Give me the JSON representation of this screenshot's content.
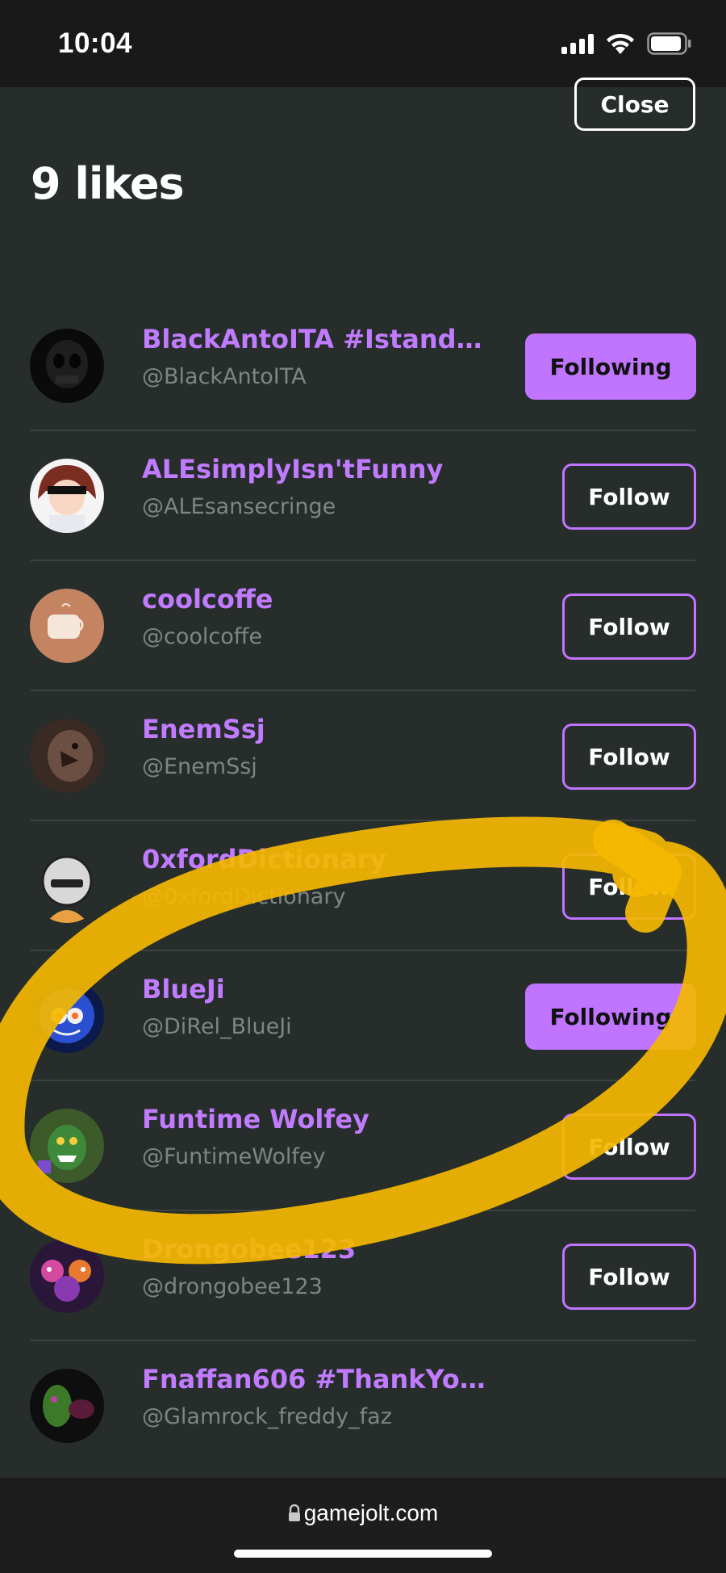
{
  "status_bar": {
    "time": "10:04"
  },
  "sheet": {
    "close_label": "Close",
    "title": "9 likes"
  },
  "users": [
    {
      "display_name": "BlackAntoITA #Istandwi...",
      "username": "@BlackAntoITA",
      "button": "Following"
    },
    {
      "display_name": "ALEsimplyIsn'tFunny",
      "username": "@ALEsansecringe",
      "button": "Follow"
    },
    {
      "display_name": "coolcoffe",
      "username": "@coolcoffe",
      "button": "Follow"
    },
    {
      "display_name": "EnemSsj",
      "username": "@EnemSsj",
      "button": "Follow"
    },
    {
      "display_name": "0xfordDictionary",
      "username": "@0xfordDictionary",
      "button": "Follow"
    },
    {
      "display_name": "BlueJi",
      "username": "@DiRel_BlueJi",
      "button": "Following"
    },
    {
      "display_name": "Funtime Wolfey",
      "username": "@FuntimeWolfey",
      "button": "Follow"
    },
    {
      "display_name": "Drongobee123",
      "username": "@drongobee123",
      "button": "Follow"
    },
    {
      "display_name": "Fnaffan606 #ThankYouScott",
      "username": "@Glamrock_freddy_faz",
      "button": ""
    }
  ],
  "browser": {
    "url": "gamejolt.com"
  },
  "colors": {
    "accent": "#c074ff",
    "background": "#262d2b",
    "highlight": "#f5b800"
  }
}
